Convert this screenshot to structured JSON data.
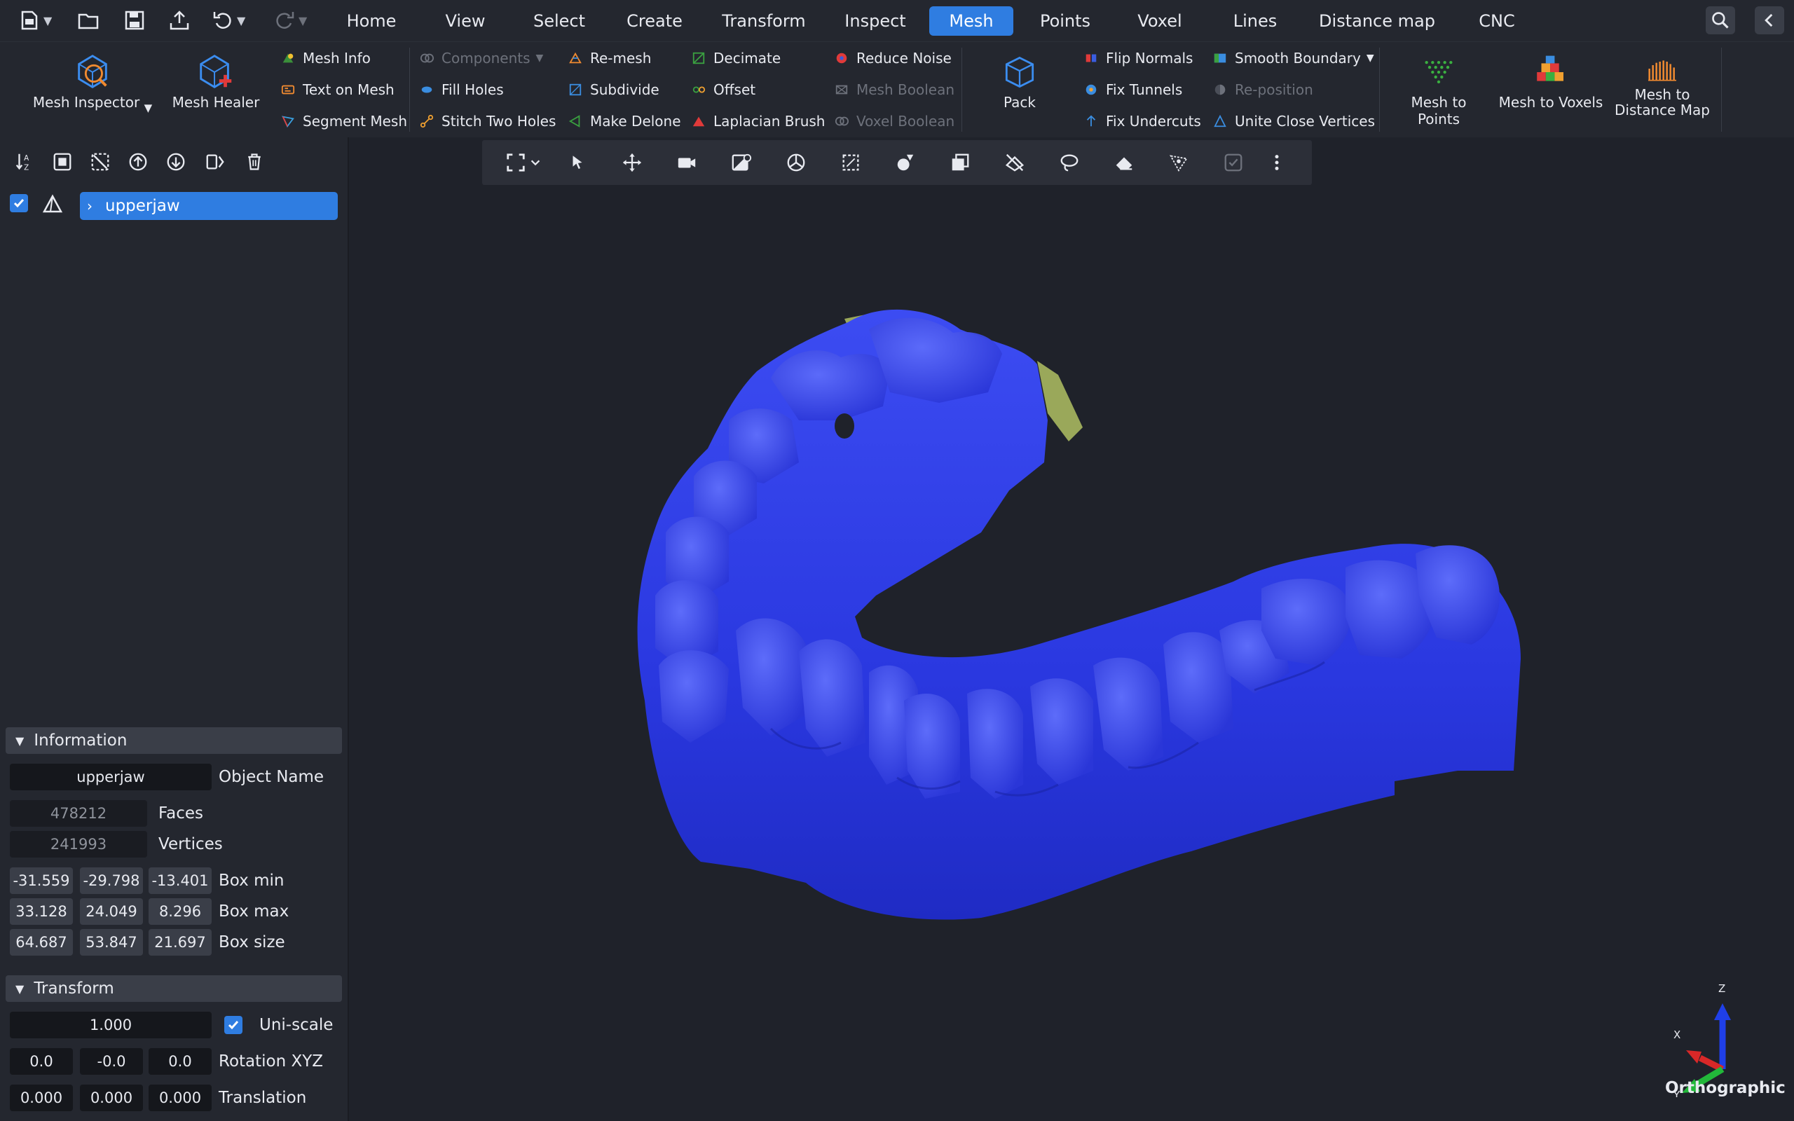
{
  "menu": {
    "tabs": [
      "Home",
      "View",
      "Select",
      "Create",
      "Transform",
      "Inspect",
      "Mesh",
      "Points",
      "Voxel",
      "Lines",
      "Distance map",
      "CNC"
    ],
    "active": "Mesh"
  },
  "ribbon": {
    "mesh_inspector": "Mesh Inspector",
    "mesh_healer": "Mesh Healer",
    "mesh_info": "Mesh Info",
    "text_on_mesh": "Text on Mesh",
    "segment_mesh": "Segment Mesh",
    "components": "Components",
    "fill_holes": "Fill Holes",
    "stitch_two_holes": "Stitch Two Holes",
    "re_mesh": "Re-mesh",
    "subdivide": "Subdivide",
    "make_delone": "Make Delone",
    "decimate": "Decimate",
    "offset": "Offset",
    "laplacian_brush": "Laplacian Brush",
    "reduce_noise": "Reduce Noise",
    "mesh_boolean": "Mesh Boolean",
    "voxel_boolean": "Voxel Boolean",
    "pack": "Pack",
    "flip_normals": "Flip Normals",
    "fix_tunnels": "Fix Tunnels",
    "fix_undercuts": "Fix Undercuts",
    "smooth_boundary": "Smooth Boundary",
    "re_position": "Re-position",
    "unite_close_vertices": "Unite Close Vertices",
    "mesh_to_points": "Mesh to Points",
    "mesh_to_voxels": "Mesh to Voxels",
    "mesh_to_distance_map_1": "Mesh to",
    "mesh_to_distance_map_2": "Distance Map"
  },
  "scene": {
    "object_name": "upperjaw"
  },
  "information": {
    "title": "Information",
    "object_name_value": "upperjaw",
    "object_name_label": "Object Name",
    "faces_value": "478212",
    "faces_label": "Faces",
    "vertices_value": "241993",
    "vertices_label": "Vertices",
    "box_min": [
      "-31.559",
      "-29.798",
      "-13.401"
    ],
    "box_min_label": "Box min",
    "box_max": [
      "33.128",
      "24.049",
      "8.296"
    ],
    "box_max_label": "Box max",
    "box_size": [
      "64.687",
      "53.847",
      "21.697"
    ],
    "box_size_label": "Box size"
  },
  "transform": {
    "title": "Transform",
    "scale_value": "1.000",
    "uniscale_label": "Uni-scale",
    "uniscale_checked": true,
    "rotation": [
      "0.0",
      "-0.0",
      "0.0"
    ],
    "rotation_label": "Rotation XYZ",
    "translation": [
      "0.000",
      "0.000",
      "0.000"
    ],
    "translation_label": "Translation"
  },
  "viewport": {
    "projection": "Orthographic",
    "axis_z": "Z",
    "axis_x": "X",
    "axis_y": "Y"
  },
  "colors": {
    "accent": "#2f7de1",
    "mesh": "#2b3be8",
    "mesh_highlight": "#5f6ff5",
    "mesh_secondary": "#9aa85a"
  }
}
